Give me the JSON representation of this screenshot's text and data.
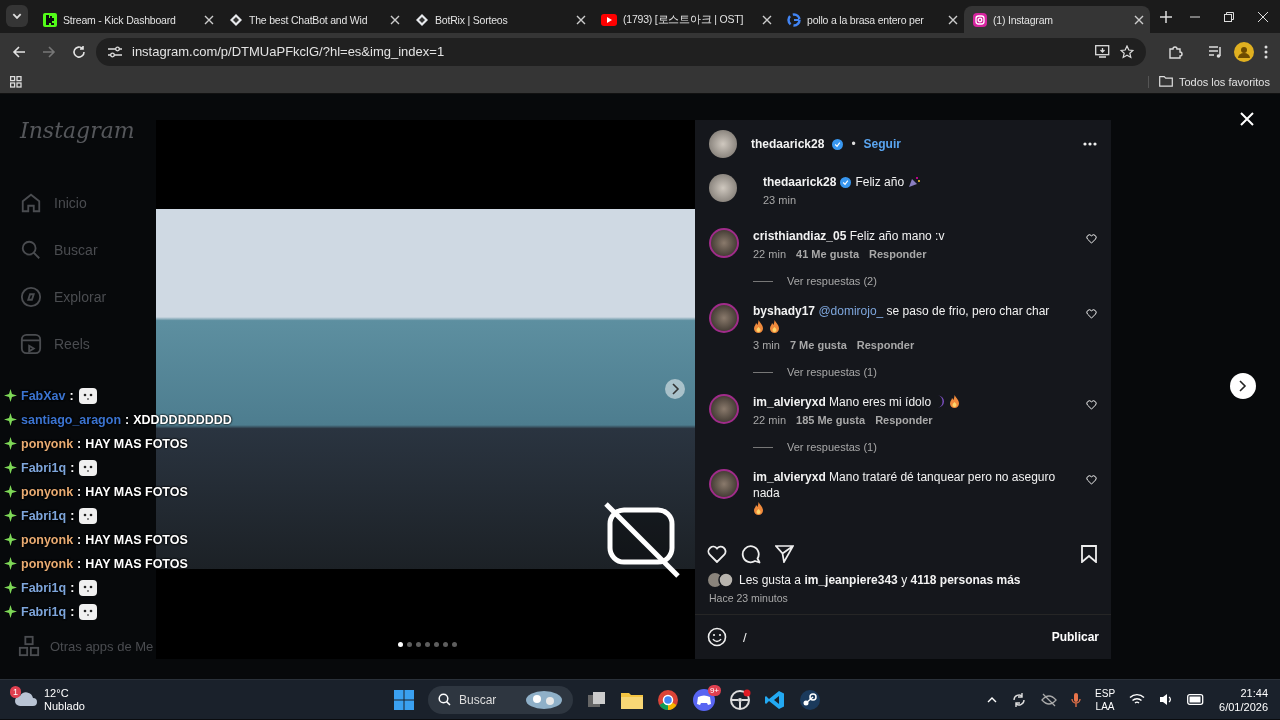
{
  "browser": {
    "tabs": [
      {
        "title": "Stream - Kick Dashboard",
        "kind": "kick",
        "selected": false
      },
      {
        "title": "The best ChatBot and Wid",
        "kind": "diamond",
        "selected": false
      },
      {
        "title": "BotRix | Sorteos",
        "kind": "diamond",
        "selected": false
      },
      {
        "title": "(1793) [로스트아크 | OST]",
        "kind": "youtube",
        "selected": false
      },
      {
        "title": "pollo a la brasa entero per",
        "kind": "google",
        "selected": false
      },
      {
        "title": "(1) Instagram",
        "kind": "instagram",
        "selected": true
      }
    ],
    "url": "instagram.com/p/DTMUaPFkclG/?hl=es&img_index=1",
    "bookmarks": "Todos los favoritos"
  },
  "sidebar": {
    "logo": "Instagram",
    "items": [
      {
        "label": "Inicio",
        "kind": "home"
      },
      {
        "label": "Buscar",
        "kind": "search"
      },
      {
        "label": "Explorar",
        "kind": "compass"
      },
      {
        "label": "Reels",
        "kind": "reels"
      }
    ],
    "more": "Otras apps de Me"
  },
  "chat": [
    {
      "user": "FabXav",
      "color": "#3b74d1",
      "colon": ":",
      "kind": "emote"
    },
    {
      "user": "santiago_aragon",
      "color": "#3b74d1",
      "colon": ":",
      "kind": "text",
      "text": "XDDDDDDDDDD"
    },
    {
      "user": "ponyonk",
      "color": "#e9ab72",
      "colon": ":",
      "kind": "text",
      "text": "HAY MAS FOTOS"
    },
    {
      "user": "Fabri1q",
      "color": "#7ea6dc",
      "colon": ":",
      "kind": "emote"
    },
    {
      "user": "ponyonk",
      "color": "#e9ab72",
      "colon": ":",
      "kind": "text",
      "text": "HAY MAS FOTOS"
    },
    {
      "user": "Fabri1q",
      "color": "#7ea6dc",
      "colon": ":",
      "kind": "emote"
    },
    {
      "user": "ponyonk",
      "color": "#e9ab72",
      "colon": ":",
      "kind": "text",
      "text": "HAY MAS FOTOS"
    },
    {
      "user": "ponyonk",
      "color": "#e9ab72",
      "colon": ":",
      "kind": "text",
      "text": "HAY MAS FOTOS"
    },
    {
      "user": "Fabri1q",
      "color": "#7ea6dc",
      "colon": ":",
      "kind": "emote"
    },
    {
      "user": "Fabri1q",
      "color": "#7ea6dc",
      "colon": ":",
      "kind": "emote"
    }
  ],
  "post": {
    "author": "thedaarick28",
    "separator": "•",
    "follow": "Seguir",
    "dots": [
      {
        "selected": true
      },
      {
        "selected": false
      },
      {
        "selected": false
      },
      {
        "selected": false
      },
      {
        "selected": false
      },
      {
        "selected": false
      },
      {
        "selected": false
      }
    ],
    "caption": {
      "user": "thedaarick28",
      "text": "Feliz año",
      "time": "23 min"
    },
    "comments": [
      {
        "user": "cristhiandiaz_05",
        "text": "Feliz año mano :v",
        "time": "22 min",
        "likes": "41 Me gusta",
        "reply": "Responder",
        "replies": "Ver respuestas (2)"
      },
      {
        "user": "byshady17",
        "mention": "@domirojo_",
        "text": "se paso de frio, pero char char",
        "reactions": [
          {
            "kind": "fire"
          },
          {
            "kind": "fire"
          }
        ],
        "time": "3 min",
        "likes": "7 Me gusta",
        "reply": "Responder",
        "replies": "Ver respuestas (1)"
      },
      {
        "user": "im_alvieryxd",
        "text": "Mano eres mi ídolo",
        "reactions": [
          {
            "kind": "moon"
          },
          {
            "kind": "fire"
          }
        ],
        "time": "22 min",
        "likes": "185 Me gusta",
        "reply": "Responder",
        "replies": "Ver respuestas (1)"
      },
      {
        "user": "im_alvieryxd",
        "text": "Mano trataré dé tanquear pero no aseguro nada",
        "reactions": [
          {
            "kind": "fire"
          }
        ]
      }
    ],
    "liked_by": "Les gusta a **im_jeanpiere343** y **4118 personas más**",
    "posted": "Hace 23 minutos",
    "comment_value": "/",
    "publish": "Publicar"
  },
  "taskbar": {
    "temp": "12°C",
    "weather": "Nublado",
    "weather_badge": "1",
    "search": "Buscar",
    "discord_badge": "9+",
    "lang": "ESP",
    "layout": "LAA",
    "time": "21:44",
    "date": "6/01/2026"
  }
}
